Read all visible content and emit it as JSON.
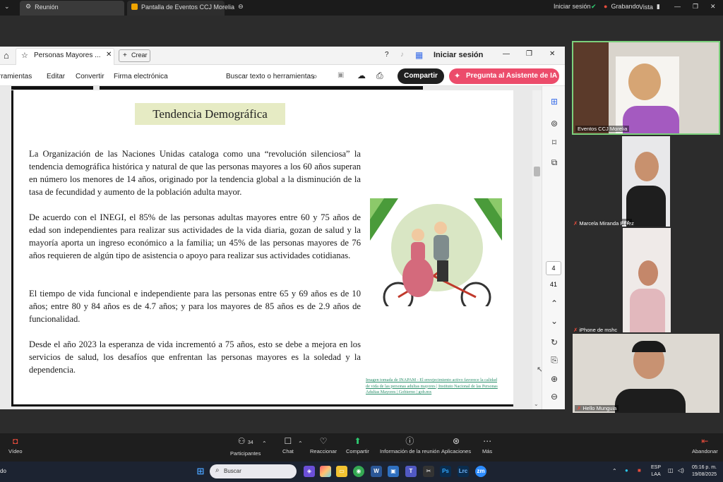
{
  "zoom_top": {
    "tab1": "Reunión",
    "tab2": "Pantalla de Eventos CCJ Morelia",
    "login": "Iniciar sesión",
    "recording": "Grabando",
    "view": "Vista"
  },
  "acrobat": {
    "tab_title": "Personas Mayores ...",
    "create": "Crear",
    "signin": "Iniciar sesión",
    "menu": [
      "rramientas",
      "Editar",
      "Convertir",
      "Firma electrónica"
    ],
    "search": "Buscar texto o herramientas",
    "share": "Compartir",
    "ai": "Pregunta al Asistente de IA",
    "page_current": "4",
    "page_total": "41"
  },
  "document": {
    "heading": "Tendencia Demográfica",
    "p1": "La Organización de las Naciones Unidas cataloga como una “revolución silenciosa” la tendencia demográfica histórica y natural de que las personas mayores a los 60 años superan en número los menores de 14 años, originado por la tendencia global a la disminución de la tasa de fecundidad y aumento de la población adulta mayor.",
    "p2": "De acuerdo con el INEGI, el 85% de las personas adultas mayores entre 60 y 75 años de edad son independientes para realizar sus actividades de la vida diaria, gozan de salud y la mayoría aporta un ingreso económico a la familia; un 45% de las personas mayores de 76 años requieren de algún tipo de asistencia o apoyo para realizar sus actividades cotidianas.",
    "p3": "El tiempo de vida funcional e independiente para las personas entre 65 y 69 años es de 10 años; entre 80 y 84 años es de 4.7 años; y para los mayores de 85 años es de 2.9 años de funcionalidad.",
    "p4": "Desde el año 2023 la esperanza de vida incrementó a 75 años, esto se debe a mejora en los servicios de salud, los desafíos que enfrentan las personas mayores es la soledad y la dependencia.",
    "caption": "Imagen tomada de INAPAM - El envejecimiento activo favorece la calidad de vida de las personas adultas mayores | Instituto Nacional de las Personas Adultas Mayores | Gobierno | gob.mx"
  },
  "participants": [
    {
      "name": "Eventos CCJ Morelia"
    },
    {
      "name": "Marcela Miranda Perez"
    },
    {
      "name": "iPhone de mshc"
    },
    {
      "name": "Hello Munguia"
    }
  ],
  "zoom_bottom": {
    "video": "Vídeo",
    "participants": "Participantes",
    "participants_count": "34",
    "chat": "Chat",
    "react": "Reaccionar",
    "share": "Compartir",
    "info": "Información de la reunión",
    "apps": "Aplicaciones",
    "more": "Más",
    "leave": "Abandonar"
  },
  "taskbar": {
    "search": "Buscar",
    "lang1": "ESP",
    "lang2": "LAA",
    "time": "05:16 p. m.",
    "date": "19/08/2025",
    "left_text": "do"
  },
  "colors": {
    "share_btn": "#1f1f1f",
    "ai_btn": "#ec4c6b",
    "heading_bg": "#e6ebc4",
    "speaker_border": "#7cd17c"
  }
}
